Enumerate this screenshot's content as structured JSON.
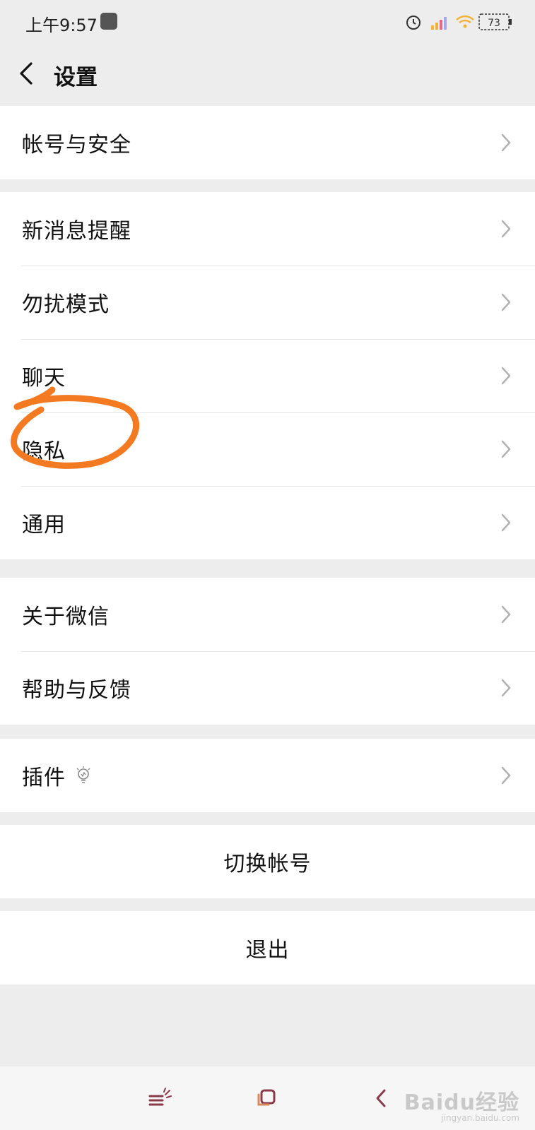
{
  "status_bar": {
    "time": "上午9:57",
    "battery": "73",
    "icons": [
      "app-notification-icon",
      "alarm-icon",
      "hd-signal-icon",
      "wifi-icon",
      "battery-icon"
    ]
  },
  "header": {
    "title": "设置",
    "back_icon": "chevron-left-icon"
  },
  "groups": [
    {
      "items": [
        {
          "label": "帐号与安全"
        }
      ]
    },
    {
      "items": [
        {
          "label": "新消息提醒"
        },
        {
          "label": "勿扰模式"
        },
        {
          "label": "聊天"
        },
        {
          "label": "隐私"
        },
        {
          "label": "通用"
        }
      ]
    },
    {
      "items": [
        {
          "label": "关于微信"
        },
        {
          "label": "帮助与反馈"
        }
      ]
    },
    {
      "items": [
        {
          "label": "插件",
          "icon": "lightbulb-icon"
        }
      ]
    }
  ],
  "actions": {
    "switch_account": "切换帐号",
    "logout": "退出"
  },
  "nav_bar": {
    "icons": [
      "menu-icon",
      "home-icon",
      "back-icon"
    ]
  },
  "watermark": {
    "main": "Baidu经验",
    "sub": "jingyan.baidu.com"
  },
  "colors": {
    "background": "#ededed",
    "annotation": "#f47a22"
  }
}
